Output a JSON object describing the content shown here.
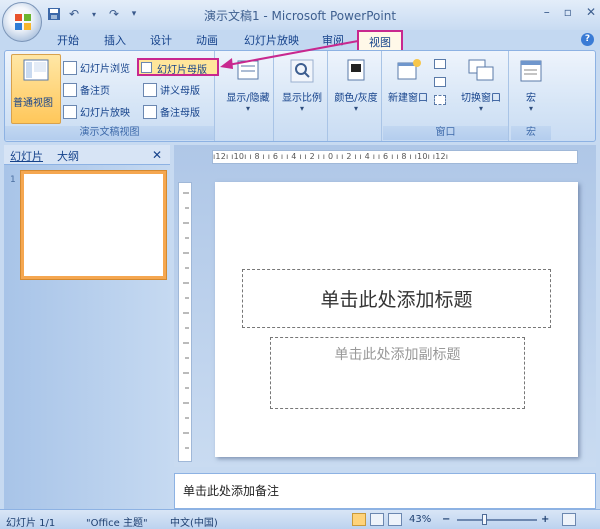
{
  "window": {
    "title": "演示文稿1 - Microsoft PowerPoint",
    "minimize": "–",
    "restore": "▫",
    "close": "✕"
  },
  "qat": {
    "save": "save-icon",
    "undo": "undo-icon",
    "redo": "redo-icon",
    "customize": "▾"
  },
  "tabs": [
    {
      "label": "开始"
    },
    {
      "label": "插入"
    },
    {
      "label": "设计"
    },
    {
      "label": "动画"
    },
    {
      "label": "幻灯片放映"
    },
    {
      "label": "审阅"
    },
    {
      "label": "视图"
    }
  ],
  "ribbon": {
    "normal_view": "普通视图",
    "slide_sorter": "幻灯片浏览",
    "notes_page": "备注页",
    "slide_show": "幻灯片放映",
    "slide_master": "幻灯片母版",
    "handout_master": "讲义母版",
    "notes_master": "备注母版",
    "group_views": "演示文稿视图",
    "show_hide": "显示/隐藏",
    "zoom": "显示比例",
    "color_gray": "颜色/灰度",
    "new_window": "新建窗口",
    "switch_window": "切换窗口",
    "group_window": "窗口",
    "macros": "宏",
    "group_macros": "宏"
  },
  "pane": {
    "tab_slides": "幻灯片",
    "tab_outline": "大纲",
    "close": "✕",
    "slide_number": "1"
  },
  "ruler": {
    "h": "ı12ı ı10ı ı 8 ı ı 6 ı ı 4 ı ı 2 ı ı 0 ı ı 2 ı ı 4 ı ı 6 ı ı 8 ı ı10ı ı12ı"
  },
  "slide": {
    "title_placeholder": "单击此处添加标题",
    "subtitle_placeholder": "单击此处添加副标题"
  },
  "notes": {
    "placeholder": "单击此处添加备注"
  },
  "status": {
    "slide": "幻灯片 1/1",
    "theme": "\"Office 主题\"",
    "language": "中文(中国)",
    "zoom": "43%",
    "zoom_minus": "−",
    "zoom_plus": "+"
  },
  "colors": {
    "highlight": "#c8288f",
    "ribbon": "#d6e5f6",
    "accent": "#f5a750"
  }
}
